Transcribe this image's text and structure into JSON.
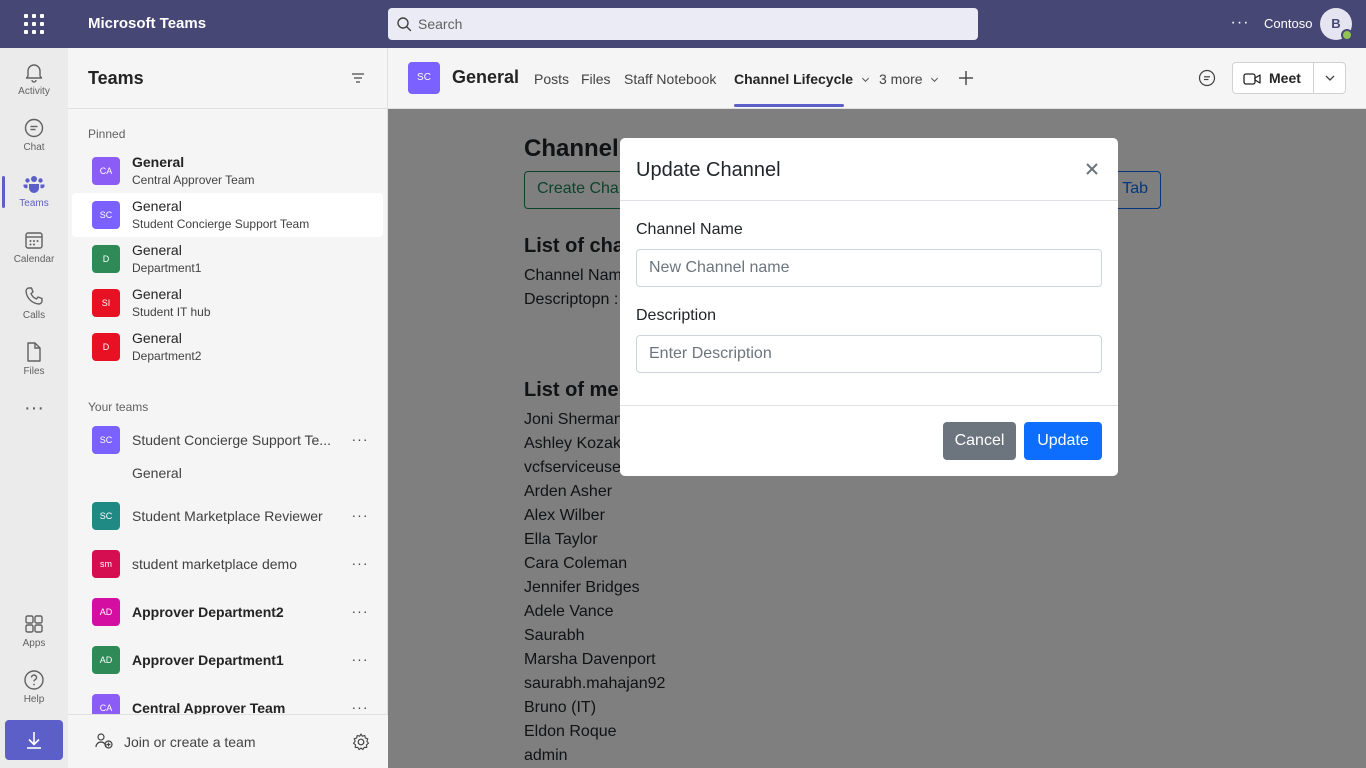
{
  "topbar": {
    "app_title": "Microsoft Teams",
    "search_placeholder": "Search",
    "more_label": "···",
    "org_name": "Contoso",
    "avatar_initial": "B",
    "color": "#464775"
  },
  "rail": {
    "items": [
      {
        "label": "Activity",
        "icon": "bell-icon"
      },
      {
        "label": "Chat",
        "icon": "chat-icon"
      },
      {
        "label": "Teams",
        "icon": "teams-icon",
        "active": true
      },
      {
        "label": "Calendar",
        "icon": "calendar-icon"
      },
      {
        "label": "Calls",
        "icon": "phone-icon"
      },
      {
        "label": "Files",
        "icon": "file-icon"
      }
    ],
    "more_label": "···",
    "bottom_items": [
      {
        "label": "Apps",
        "icon": "apps-icon"
      },
      {
        "label": "Help",
        "icon": "help-icon"
      }
    ],
    "accent": "#5b5fc7"
  },
  "teams_panel": {
    "title": "Teams",
    "pinned_label": "Pinned",
    "pinned": [
      {
        "initials": "CA",
        "title": "General",
        "subtitle": "Central Approver Team",
        "color": "#8b5cf6",
        "bold": true
      },
      {
        "initials": "SC",
        "title": "General",
        "subtitle": "Student Concierge Support Team",
        "color": "#7b61ff",
        "selected": true
      },
      {
        "initials": "D",
        "title": "General",
        "subtitle": "Department1",
        "color": "#2e8b57"
      },
      {
        "initials": "SI",
        "title": "General",
        "subtitle": "Student IT hub",
        "color": "#e81123"
      },
      {
        "initials": "D",
        "title": "General",
        "subtitle": "Department2",
        "color": "#e81123"
      }
    ],
    "your_teams_label": "Your teams",
    "teams": [
      {
        "initials": "SC",
        "name": "Student Concierge Support Te...",
        "color": "#7b61ff"
      },
      {
        "initials": "SC",
        "name": "Student Marketplace Reviewer",
        "color": "#1f8a84"
      },
      {
        "initials": "sm",
        "name": "student marketplace demo",
        "color": "#d40e50"
      },
      {
        "initials": "AD",
        "name": "Approver Department2",
        "color": "#d40ea0",
        "bold": true
      },
      {
        "initials": "AD",
        "name": "Approver Department1",
        "color": "#2e8b57",
        "bold": true
      },
      {
        "initials": "CA",
        "name": "Central Approver Team",
        "color": "#8b5cf6",
        "bold": true
      }
    ],
    "team_channel": "General",
    "more_label": "···",
    "join_label": "Join or create a team"
  },
  "channel_header": {
    "initials": "SC",
    "name": "General",
    "tabs": [
      {
        "label": "Posts"
      },
      {
        "label": "Files"
      },
      {
        "label": "Staff Notebook"
      },
      {
        "label": "Channel Lifecycle",
        "active": true
      },
      {
        "label": "3 more"
      }
    ],
    "meet_label": "Meet"
  },
  "content": {
    "title": "Channel",
    "create_button": "Create Chan",
    "tab_button": "Tab",
    "list_channels_heading": "List of char",
    "channel_name_label": "Channel Nam",
    "description_label": "Descriptopn :",
    "list_members_heading": "List of men",
    "members": [
      "Joni Sherman",
      "Ashley Kozak",
      "vcfserviceuser",
      "Arden Asher",
      "Alex Wilber",
      "Ella Taylor",
      "Cara Coleman",
      "Jennifer Bridges",
      "Adele Vance",
      "Saurabh",
      "Marsha Davenport",
      "saurabh.mahajan92",
      "Bruno (IT)",
      "Eldon Roque",
      "admin"
    ]
  },
  "modal": {
    "title": "Update Channel",
    "channel_name_label": "Channel Name",
    "channel_name_placeholder": "New Channel name",
    "channel_name_value": "",
    "description_label": "Description",
    "description_placeholder": "Enter Description",
    "description_value": "",
    "cancel_label": "Cancel",
    "update_label": "Update",
    "primary_color": "#0d6efd",
    "secondary_color": "#6c757d"
  }
}
